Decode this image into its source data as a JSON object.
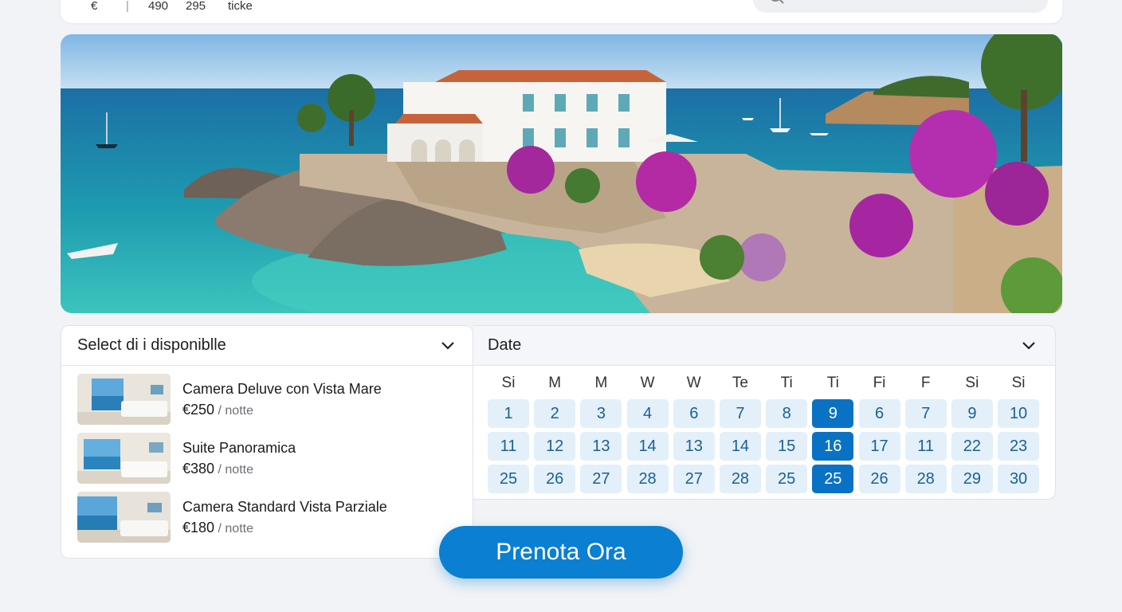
{
  "header": {
    "nav_fragments": [
      "€",
      "|",
      "490",
      "295",
      "ticke"
    ]
  },
  "rooms_dropdown": {
    "label": "Select di i disponiblle",
    "rooms": [
      {
        "name": "Camera Deluve con Vista Mare",
        "price": "€250",
        "unit": "/ notte"
      },
      {
        "name": "Suite Panoramica",
        "price": "€380",
        "unit": "/ notte"
      },
      {
        "name": "Camera Standard Vista Parziale",
        "price": "€180",
        "unit": "/ notte"
      }
    ]
  },
  "date_dropdown": {
    "label": "Date",
    "weekdays": [
      "Si",
      "M",
      "M",
      "W",
      "W",
      "Te",
      "Ti",
      "Ti",
      "Fi",
      "F",
      "Si",
      "Si"
    ],
    "days": [
      "1",
      "2",
      "3",
      "4",
      "6",
      "7",
      "8",
      "9",
      "6",
      "7",
      "9",
      "10",
      "11",
      "12",
      "13",
      "14",
      "13",
      "14",
      "15",
      "16",
      "17",
      "11",
      "22",
      "23",
      "25",
      "26",
      "27",
      "28",
      "27",
      "28",
      "25",
      "25",
      "26",
      "28",
      "29",
      "30"
    ],
    "selected_indices": [
      7,
      19,
      31
    ]
  },
  "book_button": {
    "label": "Prenota Ora"
  },
  "colors": {
    "accent": "#0b7fd1",
    "selected_day": "#0a72c4",
    "day_bg": "#e3f0f9",
    "day_text": "#1c5f93"
  }
}
